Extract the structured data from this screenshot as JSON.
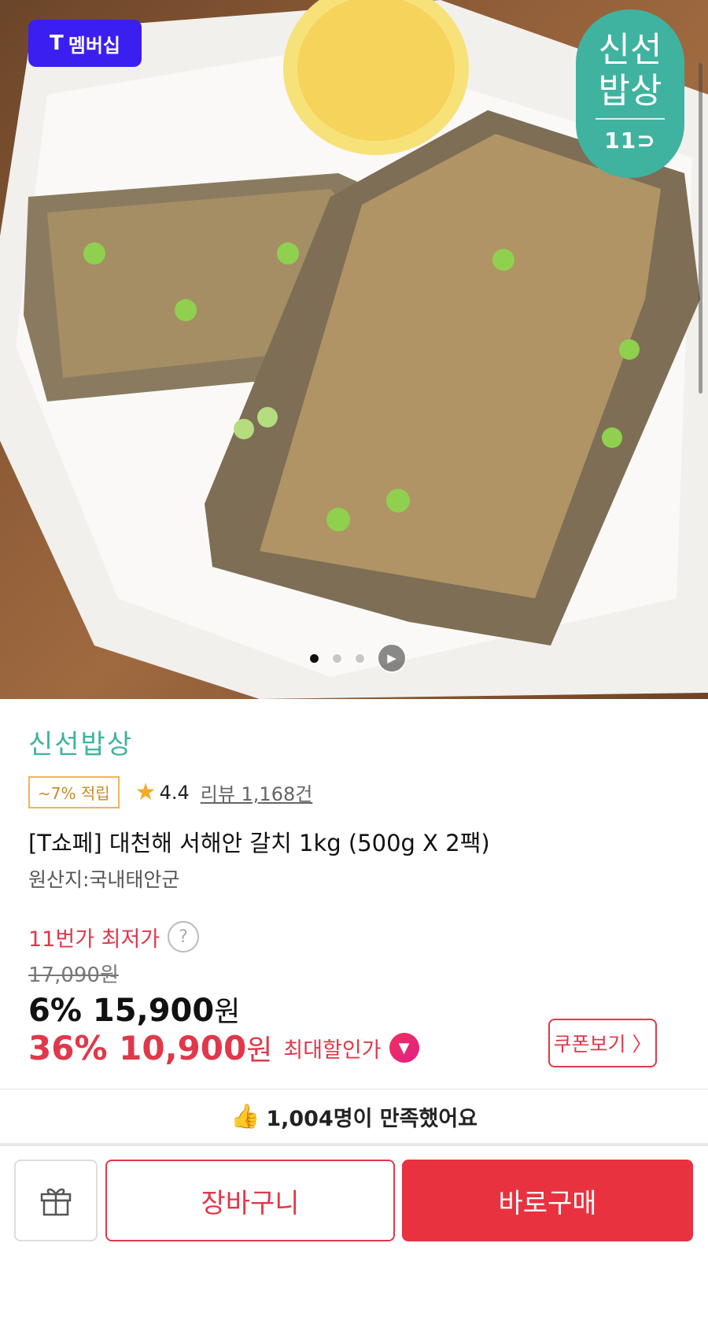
{
  "hero": {
    "membership_badge": {
      "logo": "T",
      "label": "멤버십"
    },
    "brand_badge": {
      "name_line1": "신선",
      "name_line2": "밥상",
      "logo": "11⊃"
    },
    "carousel": {
      "total_pages": 3,
      "active_index": 0
    },
    "image_alt": "grilled hairtail fish with lemon on parchment paper"
  },
  "product": {
    "seller": "신선밥상",
    "point_badge": "~7% 적립",
    "rating": "4.4",
    "review_label": "리뷰 1,168건",
    "title": "[T쇼페] 대천해 서해안 갈치 1kg (500g X 2팩)",
    "origin": "원산지:국내태안군",
    "lowest_price_label": "11번가 최저가",
    "help_icon_text": "?",
    "original_price": "17,090원",
    "price_discount_rate": "6%",
    "price_value": "15,900",
    "price_unit": "원",
    "max_discount_rate": "36%",
    "max_discount_value": "10,900",
    "max_discount_unit": "원",
    "max_discount_label": "최대할인가",
    "coupon_button": "쿠폰보기 〉"
  },
  "satisfaction": {
    "icon": "👍",
    "text": "1,004명이 만족했어요"
  },
  "bottom_bar": {
    "gift_icon": "gift-icon",
    "cart_label": "장바구니",
    "buy_label": "바로구매"
  },
  "colors": {
    "accent_red": "#e8323f",
    "brand_green": "#3fb39f",
    "membership_blue": "#3a1ff0"
  }
}
